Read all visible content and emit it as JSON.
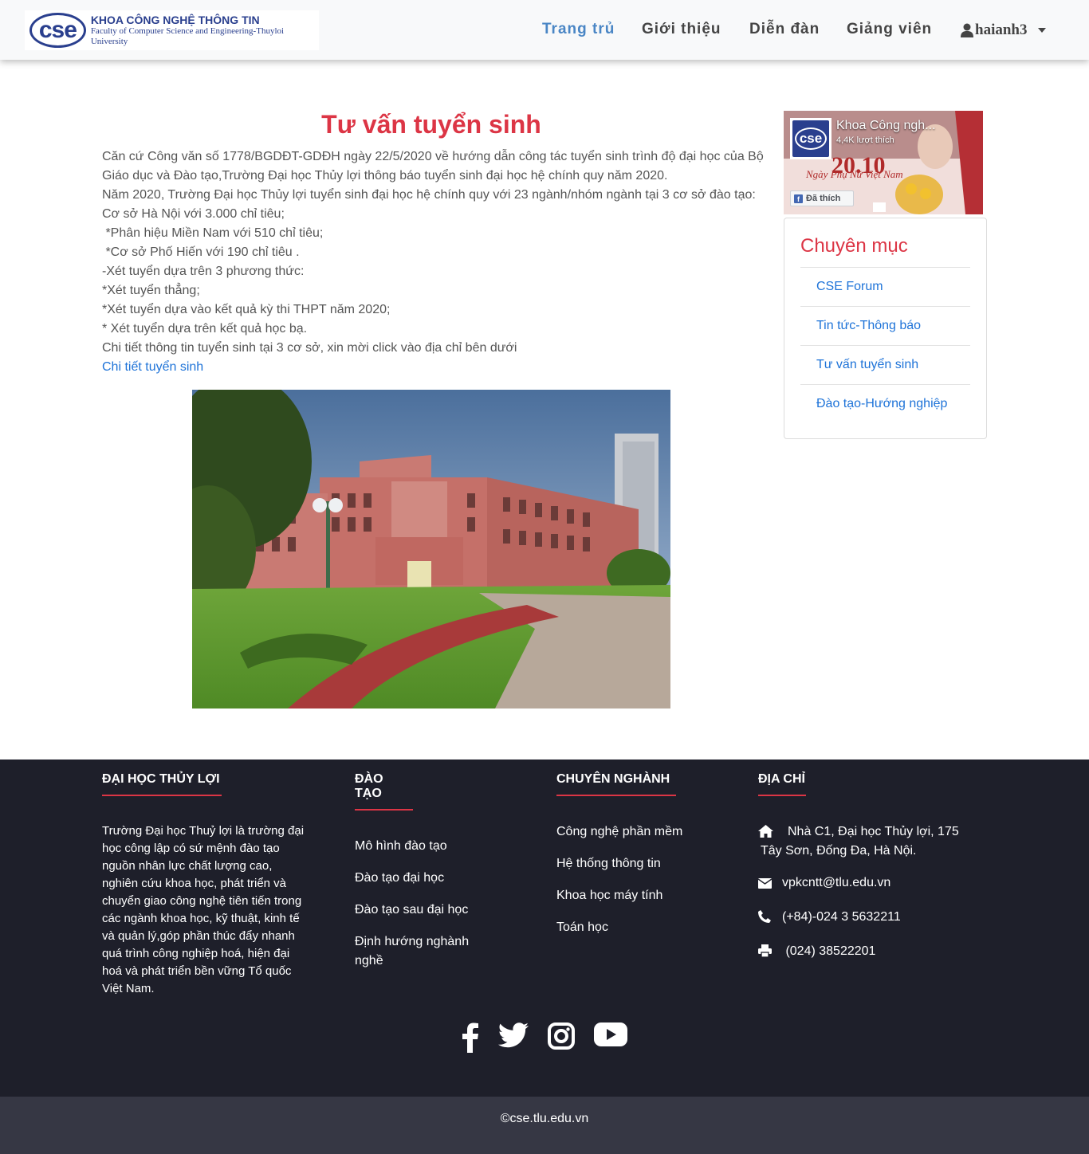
{
  "header": {
    "logo_badge": "cse",
    "logo_line1": "KHOA CÔNG NGHỆ THÔNG TIN",
    "logo_line2": "Faculty of Computer Science and Engineering-Thuyloi University",
    "nav": [
      {
        "label": "Trang trủ",
        "active": true
      },
      {
        "label": "Giới thiệu",
        "active": false
      },
      {
        "label": "Diễn đàn",
        "active": false
      },
      {
        "label": "Giảng viên",
        "active": false
      }
    ],
    "user": {
      "name": "haianh3",
      "icon": "user-icon"
    }
  },
  "article": {
    "title": "Tư vấn tuyển sinh",
    "paragraphs": [
      "Căn cứ Công văn số 1778/BGDĐT-GDĐH ngày 22/5/2020 về hướng dẫn công tác tuyển sinh trình độ đại học của Bộ Giáo dục và Đào tạo,Trường Đại học Thủy lợi thông báo tuyển sinh đại học hệ chính quy năm 2020.",
      "Năm 2020, Trường Đại học Thủy lợi tuyển sinh đại học hệ chính quy với 23 ngành/nhóm ngành tại 3 cơ sở đào tạo:",
      "Cơ sở Hà Nội với 3.000 chỉ tiêu;",
      " *Phân hiệu Miền Nam với 510 chỉ tiêu;",
      " *Cơ sở Phố Hiến với 190 chỉ tiêu .",
      "-Xét tuyển dựa trên 3 phương thức:",
      "*Xét tuyển thẳng;",
      "*Xét tuyển dựa vào kết quả kỳ thi THPT năm 2020;",
      "* Xét tuyển dựa trên kết quả học bạ.",
      "Chi tiết thông tin tuyển sinh tại 3 cơ sở, xin mời click vào địa chỉ bên dưới"
    ],
    "link": "Chi tiết tuyển sinh"
  },
  "facebook": {
    "page_name": "Khoa Công ngh...",
    "likes": "4,4K lượt thích",
    "button": "Đã thích",
    "banner_text": "20.10",
    "banner_sub": "Ngày Phụ Nữ Việt Nam"
  },
  "categories": {
    "title": "Chuyên mục",
    "items": [
      "CSE Forum",
      "Tin tức-Thông báo",
      "Tư vấn tuyển sinh",
      "Đào tạo-Hướng nghiệp"
    ]
  },
  "footer": {
    "col1": {
      "title": "ĐẠI HỌC THỦY LỢI",
      "text": "Trường Đại học Thuỷ lợi là trường đại học công lập có sứ mệnh đào tạo nguồn nhân lực chất lượng cao, nghiên cứu khoa học, phát triển và chuyển giao công nghệ tiên tiến trong các ngành khoa học, kỹ thuật, kinh tế và quản lý,góp phần thúc đẩy nhanh quá trình công nghiệp hoá, hiện đại hoá và phát triển bền vững Tổ quốc Việt Nam."
    },
    "col2": {
      "title": "ĐÀO TẠO",
      "links": [
        "Mô hình đào tạo",
        "Đào tạo đại học",
        "Đào tạo sau đại học",
        "Định hướng nghành nghề"
      ]
    },
    "col3": {
      "title": "CHUYÊN NGHÀNH",
      "links": [
        "Công nghệ phần mềm",
        "Hệ thống thông tin",
        "Khoa học máy tính",
        "Toán học"
      ]
    },
    "col4": {
      "title": "ĐỊA CHỈ",
      "address": "Nhà C1, Đại học Thủy lợi, 175 Tây Sơn, Đống Đa, Hà Nội.",
      "email": "vpkcntt@tlu.edu.vn",
      "phone": "(+84)-024 3 5632211",
      "fax": " (024) 38522201"
    },
    "social": [
      "facebook-icon",
      "twitter-icon",
      "instagram-icon",
      "youtube-icon"
    ],
    "copyright": "©cse.tlu.edu.vn"
  },
  "colors": {
    "accent": "#dc3545",
    "link": "#1e73d8",
    "nav_active": "#4a86c5",
    "footer_bg": "#1e1f2a",
    "bottom_bg": "#363744"
  }
}
